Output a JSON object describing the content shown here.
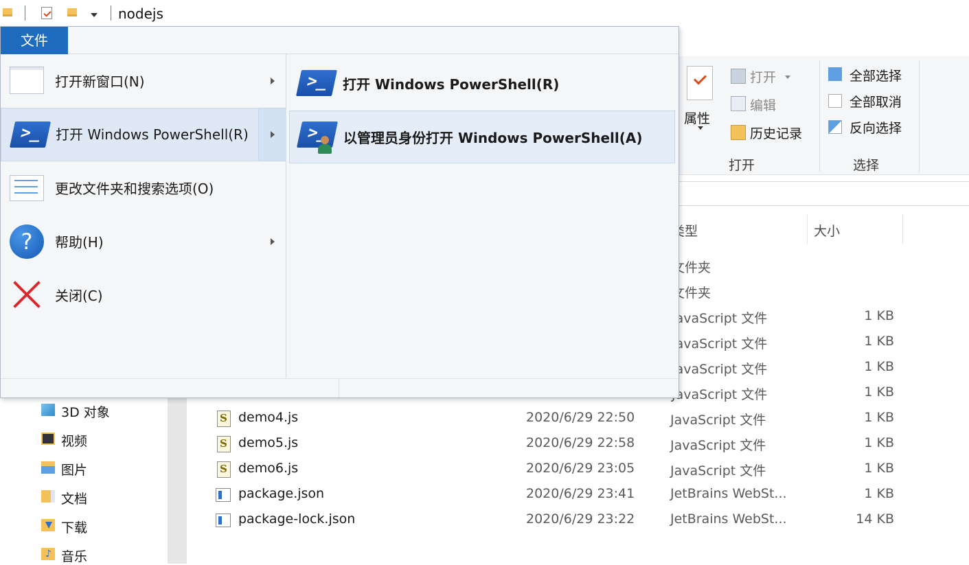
{
  "title_bar": {
    "title": "nodejs"
  },
  "ribbon": {
    "properties_label": "属性",
    "open_label": "打开",
    "edit_label": "编辑",
    "history_label": "历史记录",
    "group_open": "打开",
    "select_all_label": "全部选择",
    "select_none_label": "全部取消",
    "invert_selection_label": "反向选择",
    "group_select": "选择"
  },
  "file_list": {
    "columns": {
      "type": "类型",
      "size": "大小"
    },
    "partial_rows": [
      {
        "type": "文件夹",
        "size": ""
      },
      {
        "type": "文件夹",
        "size": ""
      },
      {
        "type": "JavaScript 文件",
        "size": "1 KB"
      },
      {
        "type": "JavaScript 文件",
        "size": "1 KB"
      },
      {
        "type": "JavaScript 文件",
        "size": "1 KB"
      },
      {
        "type": "JavaScript 文件",
        "size": "1 KB"
      }
    ],
    "rows": [
      {
        "name": "demo4.js",
        "date": "2020/6/29 22:50",
        "type": "JavaScript 文件",
        "size": "1 KB",
        "icon": "js-file-icon"
      },
      {
        "name": "demo5.js",
        "date": "2020/6/29 22:58",
        "type": "JavaScript 文件",
        "size": "1 KB",
        "icon": "js-file-icon"
      },
      {
        "name": "demo6.js",
        "date": "2020/6/29 23:05",
        "type": "JavaScript 文件",
        "size": "1 KB",
        "icon": "js-file-icon"
      },
      {
        "name": "package.json",
        "date": "2020/6/29 23:41",
        "type": "JetBrains WebSt...",
        "size": "1 KB",
        "icon": "json-file-icon"
      },
      {
        "name": "package-lock.json",
        "date": "2020/6/29 23:22",
        "type": "JetBrains WebSt...",
        "size": "14 KB",
        "icon": "json-file-icon"
      }
    ]
  },
  "nav_pane": {
    "items": [
      {
        "label": "3D 对象",
        "icon": "3d-objects-icon"
      },
      {
        "label": "视频",
        "icon": "videos-icon"
      },
      {
        "label": "图片",
        "icon": "pictures-icon"
      },
      {
        "label": "文档",
        "icon": "documents-icon"
      },
      {
        "label": "下载",
        "icon": "downloads-icon"
      },
      {
        "label": "音乐",
        "icon": "music-icon"
      }
    ]
  },
  "file_menu": {
    "tab_label": "文件",
    "items": [
      {
        "label": "打开新窗口(N)",
        "icon": "new-window-icon",
        "has_submenu": true
      },
      {
        "label": "打开 Windows PowerShell(R)",
        "icon": "powershell-icon",
        "has_submenu": true,
        "highlighted": true
      },
      {
        "label": "更改文件夹和搜索选项(O)",
        "icon": "folder-options-icon",
        "has_submenu": false
      },
      {
        "label": "帮助(H)",
        "icon": "help-icon",
        "has_submenu": true
      },
      {
        "label": "关闭(C)",
        "icon": "close-icon",
        "has_submenu": false
      }
    ],
    "submenu": [
      {
        "label": "打开 Windows PowerShell(R)",
        "icon": "powershell-icon"
      },
      {
        "label": "以管理员身份打开 Windows PowerShell(A)",
        "icon": "powershell-admin-icon",
        "highlighted": true
      }
    ]
  },
  "colors": {
    "accent": "#1e6cc0",
    "menu_bg": "#f5f6f7",
    "highlight": "#dfe9f5"
  }
}
